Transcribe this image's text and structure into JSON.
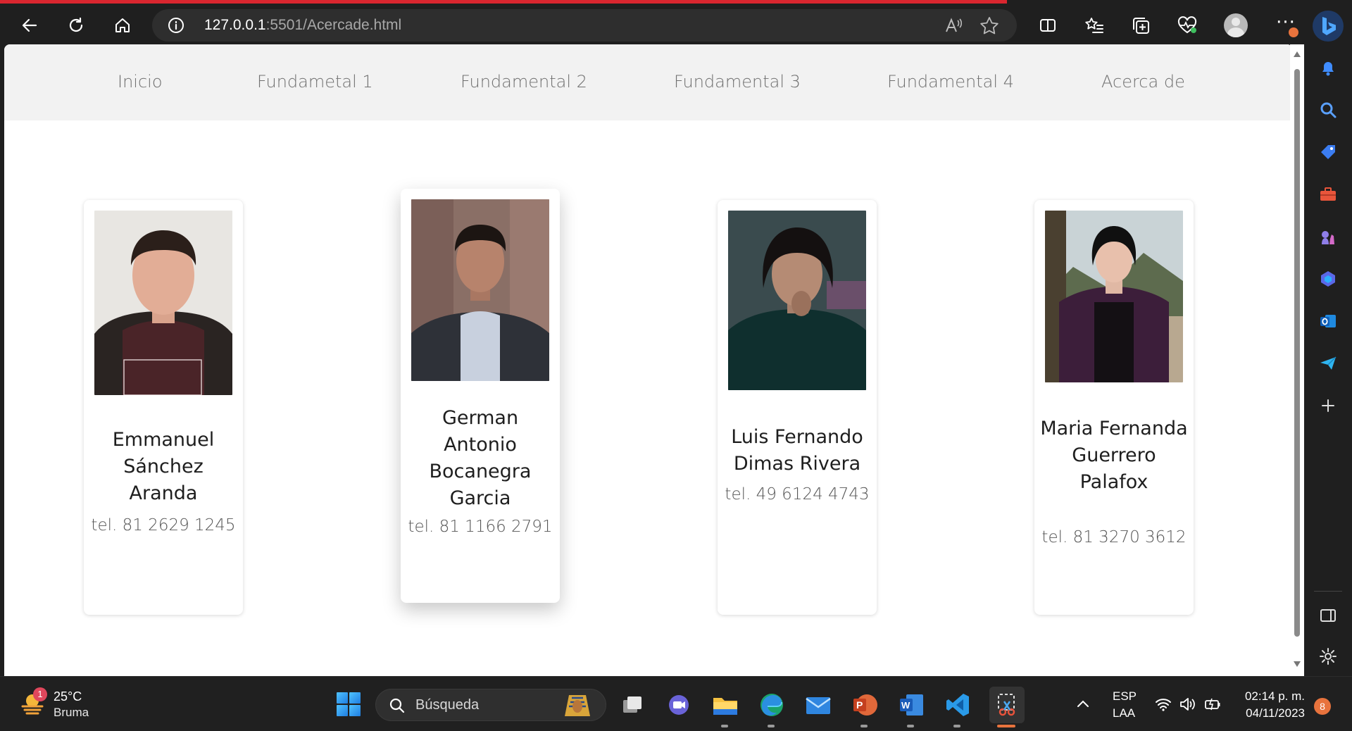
{
  "browser": {
    "address_host": "127.0.0.1",
    "address_rest": ":5501/Acercade.html"
  },
  "nav": {
    "links": [
      "Inicio",
      "Fundametal 1",
      "Fundamental 2",
      "Fundamental 3",
      "Fundamental 4",
      "Acerca de"
    ]
  },
  "cards": [
    {
      "name": "Emmanuel Sánchez Aranda",
      "tel": "tel. 81 2629 1245"
    },
    {
      "name": "German Antonio Bocanegra Garcia",
      "tel": "tel. 81 1166 2791"
    },
    {
      "name": "Luis Fernando Dimas Rivera",
      "tel": "tel. 49 6124 4743"
    },
    {
      "name": "Maria Fernanda Guerrero Palafox",
      "tel": "tel. 81 3270 3612"
    }
  ],
  "taskbar": {
    "weather_badge": "1",
    "weather_temp": "25°C",
    "weather_desc": "Bruma",
    "search_placeholder": "Búsqueda",
    "lang_top": "ESP",
    "lang_bottom": "LAA",
    "time": "02:14 p. m.",
    "date": "04/11/2023",
    "notification_count": "8"
  }
}
